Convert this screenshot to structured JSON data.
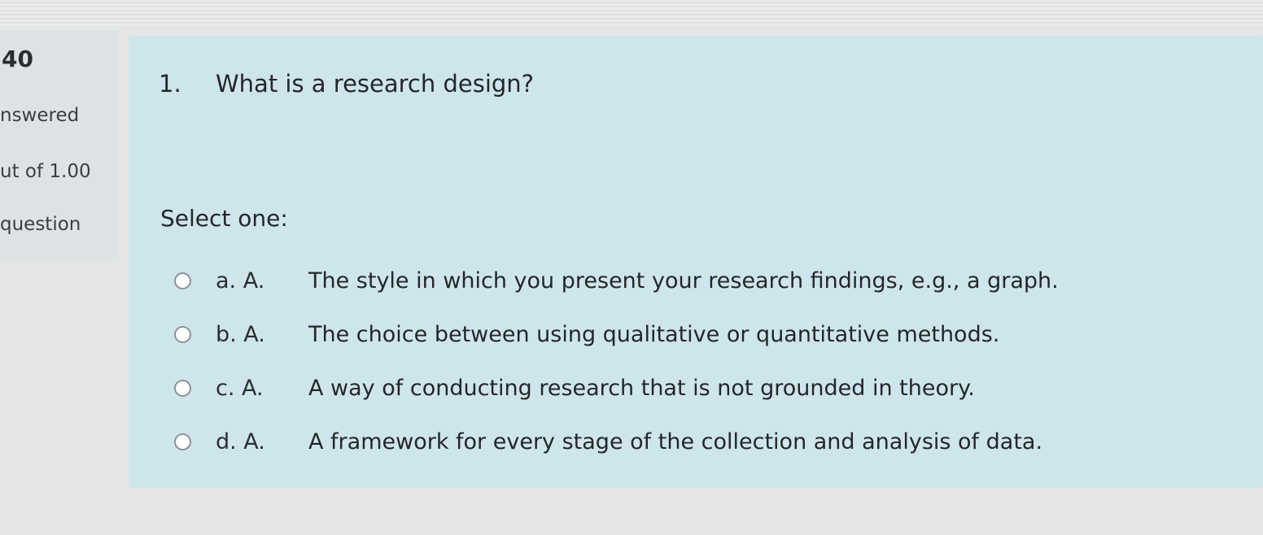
{
  "info": {
    "question_number": "40",
    "status": "nswered",
    "mark": "ut of 1.00",
    "flag_label": "question"
  },
  "question": {
    "number": "1.",
    "text": "What is a research design?",
    "prompt": "Select one:",
    "options": [
      {
        "letter": "a. A.",
        "text": "The style in which you present your research findings, e.g., a graph."
      },
      {
        "letter": "b. A.",
        "text": "The choice between using qualitative or quantitative methods."
      },
      {
        "letter": "c. A.",
        "text": "A way of conducting research that is not grounded in theory."
      },
      {
        "letter": "d. A.",
        "text": "A framework for every stage of the collection and analysis of data."
      }
    ]
  },
  "colors": {
    "content_background": "#cfe5ec",
    "info_background": "#dde2e5",
    "page_background": "#e4e6e5"
  }
}
